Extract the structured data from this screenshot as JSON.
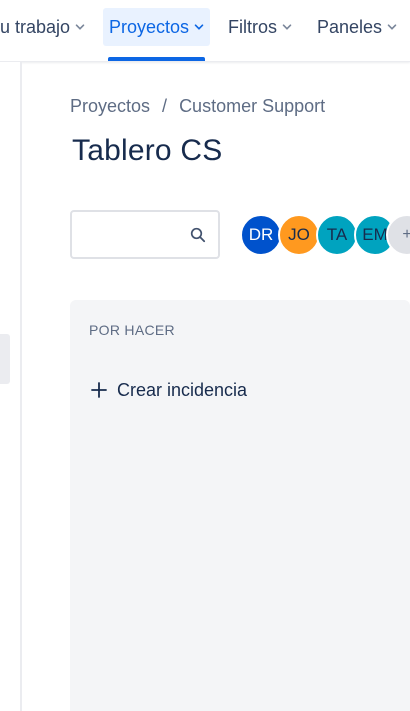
{
  "topnav": {
    "items": [
      {
        "label": "u trabajo"
      },
      {
        "label": "Proyectos",
        "active": true
      },
      {
        "label": "Filtros"
      },
      {
        "label": "Paneles"
      }
    ]
  },
  "breadcrumb": {
    "items": [
      "Proyectos",
      "Customer Support"
    ],
    "separator": "/"
  },
  "page": {
    "title": "Tablero CS"
  },
  "search": {
    "value": "",
    "placeholder": ""
  },
  "avatars": [
    {
      "initials": "DR",
      "bg": "#0052cc",
      "fg": "#ffffff"
    },
    {
      "initials": "JO",
      "bg": "#ff991f",
      "fg": "#172b4d"
    },
    {
      "initials": "TA",
      "bg": "#00a3bf",
      "fg": "#172b4d"
    },
    {
      "initials": "EM",
      "bg": "#00a3bf",
      "fg": "#172b4d"
    },
    {
      "initials": "+",
      "bg": "#dfe1e6",
      "fg": "#5e6c84"
    }
  ],
  "board": {
    "columns": [
      {
        "title": "POR HACER",
        "create_label": "Crear incidencia"
      }
    ]
  },
  "colors": {
    "accent": "#0c66e4",
    "active_bg": "#e9f2ff",
    "column_bg": "#f4f5f7"
  },
  "icons": {
    "nav_chevron": "chevron-down-icon",
    "search": "search-icon",
    "create": "plus-icon"
  }
}
